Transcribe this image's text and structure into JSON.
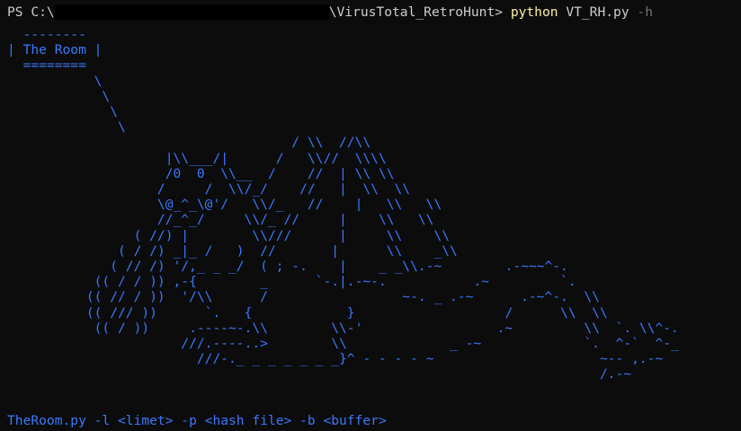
{
  "prompt": {
    "ps_prefix": "PS C:\\",
    "path_suffix": "\\VirusTotal_RetroHunt>",
    "command": "python",
    "script": "VT_RH.py",
    "flag": "-h"
  },
  "art": {
    "lines": [
      "  --------",
      "| The Room |",
      "  ========",
      "           \\",
      "            \\",
      "             \\",
      "              \\",
      "                                    / \\\\  //\\\\",
      "                    |\\\\___/|      /   \\\\//  \\\\\\\\",
      "                    /0  0  \\\\__  /    //  | \\\\ \\\\",
      "                   /     /  \\\\/_/    //   |  \\\\  \\\\",
      "                   \\@_^_\\@'/   \\\\/_   //    |   \\\\   \\\\",
      "                   //_^_/     \\\\/_ //     |    \\\\   \\\\",
      "                ( //) |        \\\\///      |     \\\\    \\\\",
      "              ( / /) _|_ /   )  //       |      \\\\    _\\\\",
      "             ( // /) '/,_ _ _/  ( ; -.    |    _ _\\\\.-~        .-~~~^-.",
      "           (( / / )) ,-{        _      `-.|.-~-.           .~         `.",
      "          (( // / ))  '/\\\\      /                 ~-. _ .-~      .-~^-.  \\\\",
      "          (( /// ))      `.   {            }                   /      \\\\  \\\\",
      "           (( / ))     .----~-.\\\\        \\\\-'                 .~         \\\\  `. \\\\^-.",
      "                      ///.----..>        \\\\             _ -~             `.  ^-`  ^-_",
      "                        ///-._ _ _ _ _ _ _}^ - - - - ~                     ~-- ,.-~",
      "                                                                           /.-~"
    ]
  },
  "usage": "TheRoom.py -l <limet> -p <hash file> -b <buffer>",
  "colors": {
    "background": "#0c0c0c",
    "text": "#cccccc",
    "art": "#3b78ff",
    "command": "#f9f1a5",
    "flag": "#767676"
  }
}
